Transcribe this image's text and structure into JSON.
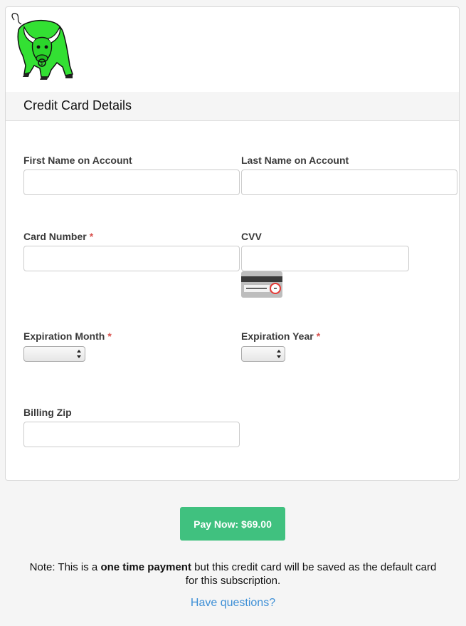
{
  "header": {
    "logo_icon": "green-bull-logo"
  },
  "panel": {
    "title": "Credit Card Details"
  },
  "form": {
    "first_name": {
      "label": "First Name on Account",
      "value": ""
    },
    "last_name": {
      "label": "Last Name on Account",
      "value": ""
    },
    "card_number": {
      "label": "Card Number",
      "required": "*",
      "value": ""
    },
    "cvv": {
      "label": "CVV",
      "value": "",
      "hint_icon": "cvv-card-back-icon"
    },
    "exp_month": {
      "label": "Expiration Month",
      "required": "*",
      "selected": ""
    },
    "exp_year": {
      "label": "Expiration Year",
      "required": "*",
      "selected": ""
    },
    "billing_zip": {
      "label": "Billing Zip",
      "value": ""
    }
  },
  "actions": {
    "pay_label": "Pay Now: $69.00",
    "pay_color": "#40c17f"
  },
  "note": {
    "prefix": "Note: This is a ",
    "emphasis": "one time payment",
    "suffix": " but this credit card will be saved as the default card for this subscription."
  },
  "help": {
    "link_text": "Have questions?",
    "link_color": "#3d8fd6"
  }
}
